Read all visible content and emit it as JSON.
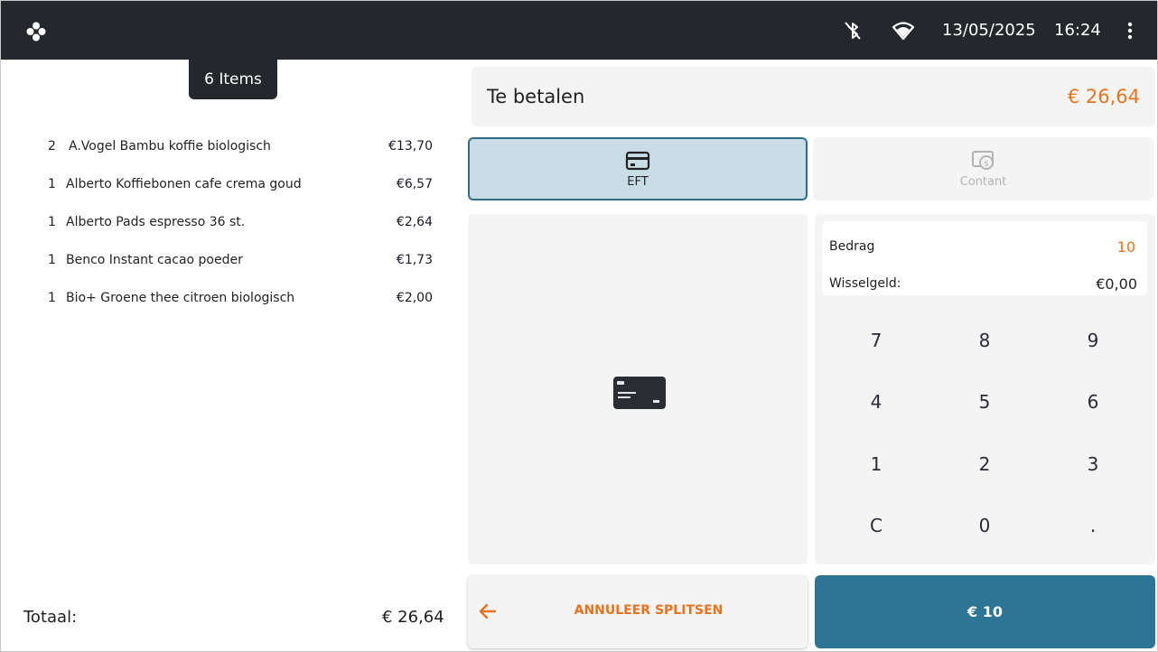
{
  "topbar": {
    "date": "13/05/2025",
    "time": "16:24",
    "icons": [
      "flower-logo-icon",
      "bluetooth-off-icon",
      "wifi-icon",
      "more-vertical-icon"
    ]
  },
  "order": {
    "items_tab": "6 Items",
    "rows": [
      {
        "qty": "2",
        "name": "A.Vogel Bambu koffie biologisch",
        "price": "€13,70"
      },
      {
        "qty": "1",
        "name": "Alberto Koffiebonen cafe crema goud",
        "price": "€6,57"
      },
      {
        "qty": "1",
        "name": "Alberto Pads espresso 36 st.",
        "price": "€2,64"
      },
      {
        "qty": "1",
        "name": "Benco Instant cacao poeder",
        "price": "€1,73"
      },
      {
        "qty": "1",
        "name": "Bio+ Groene thee citroen biologisch",
        "price": "€2,00"
      }
    ],
    "total_label": "Totaal:",
    "total_value": "€ 26,64"
  },
  "payment": {
    "due_label": "Te betalen",
    "due_amount": "€ 26,64",
    "methods": [
      {
        "label": "EFT",
        "icon": "credit-card-icon",
        "selected": true
      },
      {
        "label": "Contant",
        "icon": "cash-icon",
        "selected": false
      }
    ],
    "amount_label": "Bedrag",
    "amount_value": "10",
    "change_label": "Wisselgeld:",
    "change_value": "€0,00",
    "keys": [
      "7",
      "8",
      "9",
      "4",
      "5",
      "6",
      "1",
      "2",
      "3",
      "C",
      "0",
      "."
    ],
    "cancel_label": "ANNULEER SPLITSEN",
    "pay_label": "€ 10"
  },
  "colors": {
    "topbar": "#24272b",
    "accent_orange": "#e8731c",
    "primary_blue": "#2c7594",
    "selected_bg": "#c8dde6",
    "panel_bg": "#f4f4f4"
  }
}
